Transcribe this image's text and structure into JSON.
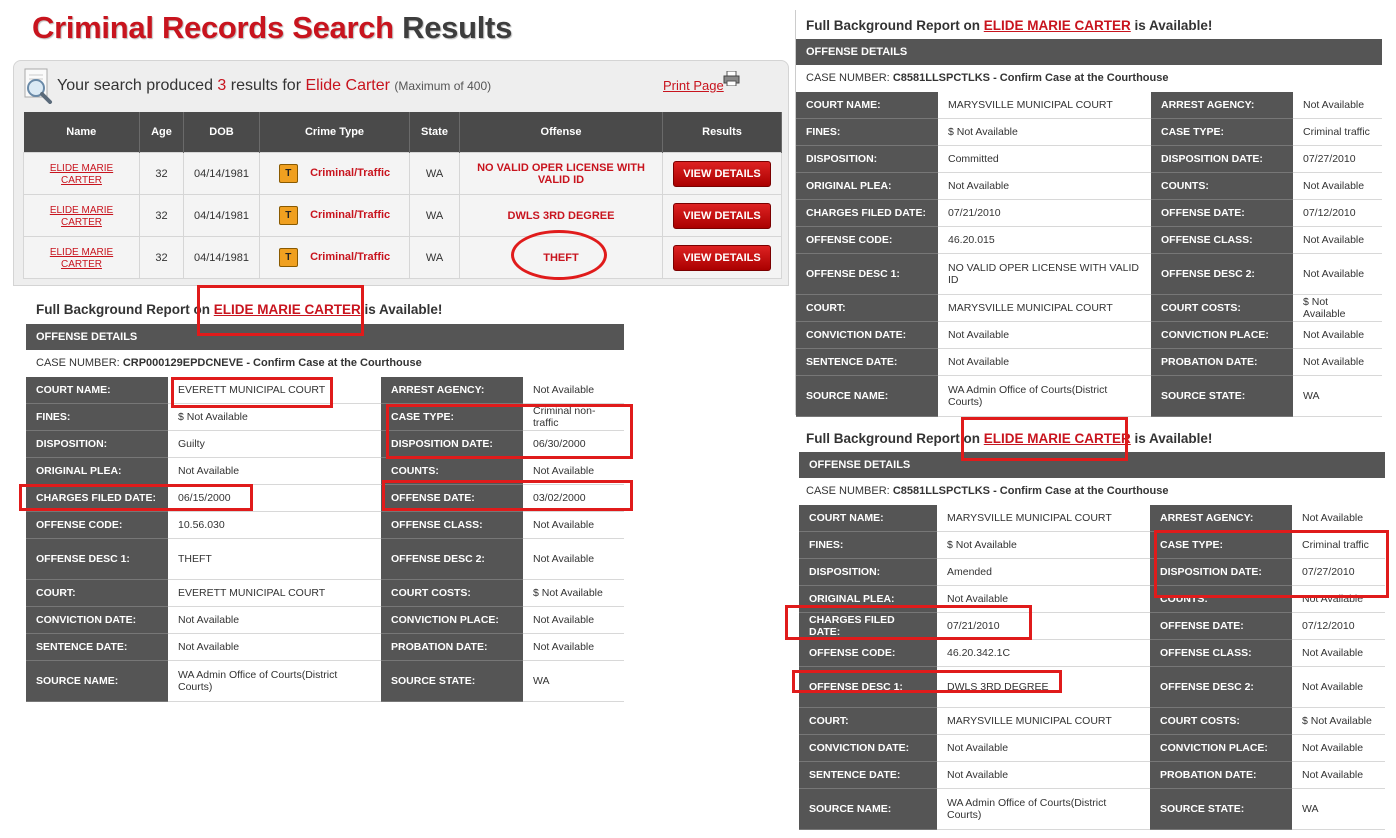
{
  "title": {
    "part1": "Criminal Records Search",
    "part2": "Results"
  },
  "summary": {
    "prefix": "Your search produced",
    "count": "3",
    "mid": "results for",
    "query": "Elide Carter",
    "max": "(Maximum of 400)"
  },
  "print_page": "Print Page",
  "results_table": {
    "headers": [
      "Name",
      "Age",
      "DOB",
      "Crime Type",
      "State",
      "Offense",
      "Results"
    ],
    "badge": "T",
    "button": "VIEW DETAILS",
    "rows": [
      {
        "name": "ELIDE MARIE CARTER",
        "age": "32",
        "dob": "04/14/1981",
        "crime_type": "Criminal/Traffic",
        "state": "WA",
        "offense": "NO VALID OPER LICENSE WITH VALID ID"
      },
      {
        "name": "ELIDE MARIE CARTER",
        "age": "32",
        "dob": "04/14/1981",
        "crime_type": "Criminal/Traffic",
        "state": "WA",
        "offense": "DWLS 3RD DEGREE"
      },
      {
        "name": "ELIDE MARIE CARTER",
        "age": "32",
        "dob": "04/14/1981",
        "crime_type": "Criminal/Traffic",
        "state": "WA",
        "offense": "THEFT"
      }
    ]
  },
  "report_labels": {
    "title_prefix": "Full Background Report on",
    "title_suffix": "is Available!",
    "name": "ELIDE MARIE CARTER",
    "offense_details": "OFFENSE DETAILS",
    "case_prefix": "CASE NUMBER:",
    "case_suffix": "- Confirm Case at the Courthouse"
  },
  "reports": [
    {
      "case_number": "CRP000129EPDCNEVE",
      "rows": [
        [
          "COURT NAME:",
          "EVERETT MUNICIPAL COURT",
          "ARREST AGENCY:",
          "Not Available"
        ],
        [
          "FINES:",
          "$ Not Available",
          "CASE TYPE:",
          "Criminal non-traffic"
        ],
        [
          "DISPOSITION:",
          "Guilty",
          "DISPOSITION DATE:",
          "06/30/2000"
        ],
        [
          "ORIGINAL PLEA:",
          "Not Available",
          "COUNTS:",
          "Not Available"
        ],
        [
          "CHARGES FILED DATE:",
          "06/15/2000",
          "OFFENSE DATE:",
          "03/02/2000"
        ],
        [
          "OFFENSE CODE:",
          "10.56.030",
          "OFFENSE CLASS:",
          "Not Available"
        ],
        [
          "OFFENSE DESC 1:",
          "THEFT",
          "OFFENSE DESC 2:",
          "Not Available"
        ],
        [
          "COURT:",
          "EVERETT MUNICIPAL COURT",
          "COURT COSTS:",
          "$ Not Available"
        ],
        [
          "CONVICTION DATE:",
          "Not Available",
          "CONVICTION PLACE:",
          "Not Available"
        ],
        [
          "SENTENCE DATE:",
          "Not Available",
          "PROBATION DATE:",
          "Not Available"
        ],
        [
          "SOURCE NAME:",
          "WA Admin Office of Courts(District Courts)",
          "SOURCE STATE:",
          "WA"
        ]
      ]
    },
    {
      "case_number": "C8581LLSPCTLKS",
      "rows": [
        [
          "COURT NAME:",
          "MARYSVILLE MUNICIPAL COURT",
          "ARREST AGENCY:",
          "Not Available"
        ],
        [
          "FINES:",
          "$ Not Available",
          "CASE TYPE:",
          "Criminal traffic"
        ],
        [
          "DISPOSITION:",
          "Committed",
          "DISPOSITION DATE:",
          "07/27/2010"
        ],
        [
          "ORIGINAL PLEA:",
          "Not Available",
          "COUNTS:",
          "Not Available"
        ],
        [
          "CHARGES FILED DATE:",
          "07/21/2010",
          "OFFENSE DATE:",
          "07/12/2010"
        ],
        [
          "OFFENSE CODE:",
          "46.20.015",
          "OFFENSE CLASS:",
          "Not Available"
        ],
        [
          "OFFENSE DESC 1:",
          "NO VALID OPER LICENSE WITH VALID ID",
          "OFFENSE DESC 2:",
          "Not Available"
        ],
        [
          "COURT:",
          "MARYSVILLE MUNICIPAL COURT",
          "COURT COSTS:",
          "$ Not Available"
        ],
        [
          "CONVICTION DATE:",
          "Not Available",
          "CONVICTION PLACE:",
          "Not Available"
        ],
        [
          "SENTENCE DATE:",
          "Not Available",
          "PROBATION DATE:",
          "Not Available"
        ],
        [
          "SOURCE NAME:",
          "WA Admin Office of Courts(District Courts)",
          "SOURCE STATE:",
          "WA"
        ]
      ]
    },
    {
      "case_number": "C8581LLSPCTLKS",
      "rows": [
        [
          "COURT NAME:",
          "MARYSVILLE MUNICIPAL COURT",
          "ARREST AGENCY:",
          "Not Available"
        ],
        [
          "FINES:",
          "$ Not Available",
          "CASE TYPE:",
          "Criminal traffic"
        ],
        [
          "DISPOSITION:",
          "Amended",
          "DISPOSITION DATE:",
          "07/27/2010"
        ],
        [
          "ORIGINAL PLEA:",
          "Not Available",
          "COUNTS:",
          "Not Available"
        ],
        [
          "CHARGES FILED DATE:",
          "07/21/2010",
          "OFFENSE DATE:",
          "07/12/2010"
        ],
        [
          "OFFENSE CODE:",
          "46.20.342.1C",
          "OFFENSE CLASS:",
          "Not Available"
        ],
        [
          "OFFENSE DESC 1:",
          "DWLS 3RD DEGREE",
          "OFFENSE DESC 2:",
          "Not Available"
        ],
        [
          "COURT:",
          "MARYSVILLE MUNICIPAL COURT",
          "COURT COSTS:",
          "$ Not Available"
        ],
        [
          "CONVICTION DATE:",
          "Not Available",
          "CONVICTION PLACE:",
          "Not Available"
        ],
        [
          "SENTENCE DATE:",
          "Not Available",
          "PROBATION DATE:",
          "Not Available"
        ],
        [
          "SOURCE NAME:",
          "WA Admin Office of Courts(District Courts)",
          "SOURCE STATE:",
          "WA"
        ]
      ]
    }
  ],
  "colors": {
    "brand_red": "#c8141e",
    "header_gray": "#4a4a4a",
    "annotation_red": "#e01b1b"
  }
}
